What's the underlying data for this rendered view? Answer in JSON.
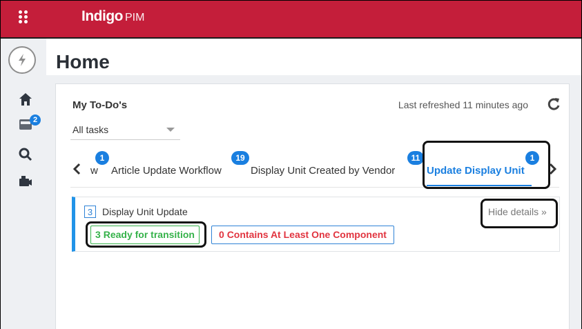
{
  "app": {
    "logo_brand": "Indigo",
    "logo_suffix": "PIM"
  },
  "sidebar": {
    "notification_count": "2"
  },
  "page": {
    "title": "Home"
  },
  "todos": {
    "title": "My To-Do's",
    "last_refreshed": "Last refreshed 11 minutes ago",
    "filter": {
      "selected": "All tasks"
    },
    "tabs": [
      {
        "label": "w",
        "count": "1"
      },
      {
        "label": "Article Update Workflow",
        "count": "19"
      },
      {
        "label": "Display Unit Created by Vendor",
        "count": "11"
      },
      {
        "label": "Update Display Unit",
        "count": "1",
        "active": true
      }
    ],
    "detail": {
      "count": "3",
      "title": "Display Unit Update",
      "hide_details": "Hide details »",
      "ready_label": "3 Ready for transition",
      "contains_label": "0 Contains At Least One Component"
    }
  },
  "colors": {
    "brand": "#c41e3a",
    "accent": "#1a7fe0",
    "success": "#35b24a",
    "danger": "#e1343f"
  },
  "icons": [
    "app-grid-icon",
    "bolt-icon",
    "home-icon",
    "inbox-icon",
    "search-icon",
    "camera-icon",
    "refresh-icon",
    "chevron-left-icon",
    "chevron-right-icon"
  ]
}
